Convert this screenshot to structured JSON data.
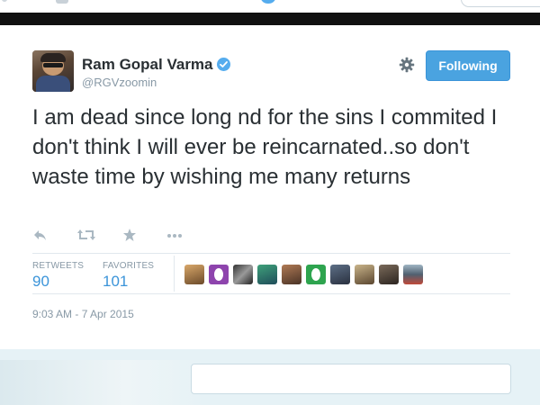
{
  "tweet": {
    "author_name": "Ram Gopal Varma",
    "author_handle": "@RGVzoomin",
    "verified": true,
    "follow_button_label": "Following",
    "text": "I am dead since long nd for the sins I commited I don't think I will ever be reincarnated..so don't waste time by wishing me many returns",
    "actions": [
      {
        "name": "reply-icon"
      },
      {
        "name": "retweet-icon"
      },
      {
        "name": "favorite-icon"
      },
      {
        "name": "more-icon"
      }
    ],
    "stats": {
      "retweets_label": "RETWEETS",
      "retweets_value": "90",
      "favorites_label": "FAVORITES",
      "favorites_value": "101"
    },
    "favoriter_avatar_count": 11,
    "timestamp": "9:03 AM - 7 Apr 2015"
  },
  "colors": {
    "accent": "#55acee",
    "follow_button_bg": "#4aa3e0",
    "stat_value": "#3b94d9",
    "muted_text": "#8899a6"
  },
  "icons": {
    "settings": "gear-icon",
    "verified": "verified-badge-icon"
  }
}
